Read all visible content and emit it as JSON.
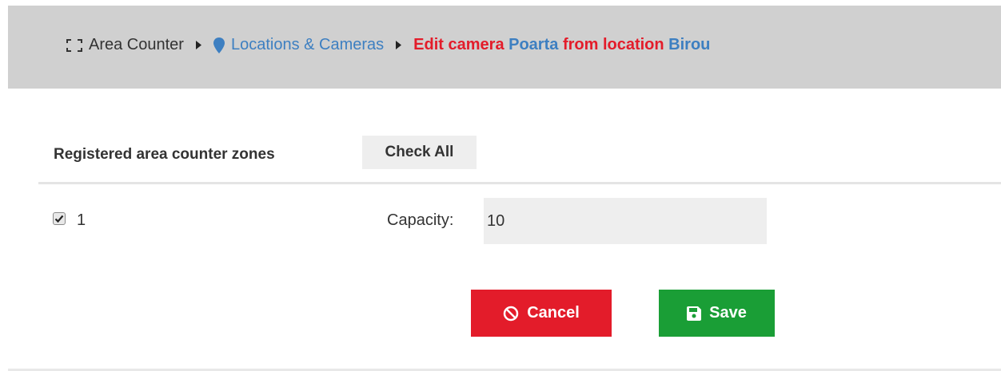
{
  "breadcrumb": {
    "app_label": "Area Counter",
    "locations_label": "Locations & Cameras",
    "current": {
      "prefix": "Edit camera",
      "camera": "Poarta",
      "middle": "from location",
      "location": "Birou"
    },
    "icons": [
      "expand-icon",
      "caret-right-icon",
      "map-marker-icon"
    ]
  },
  "zones": {
    "heading": "Registered area counter zones",
    "check_all_label": "Check All",
    "items": [
      {
        "label": "1",
        "checked": true,
        "capacity_label": "Capacity:",
        "capacity_value": "10"
      }
    ]
  },
  "actions": {
    "cancel_label": "Cancel",
    "save_label": "Save"
  },
  "colors": {
    "header_bg": "#d0d0d0",
    "link_blue": "#3d7fc1",
    "danger_red": "#e31c2a",
    "success_green": "#1a9e36"
  }
}
